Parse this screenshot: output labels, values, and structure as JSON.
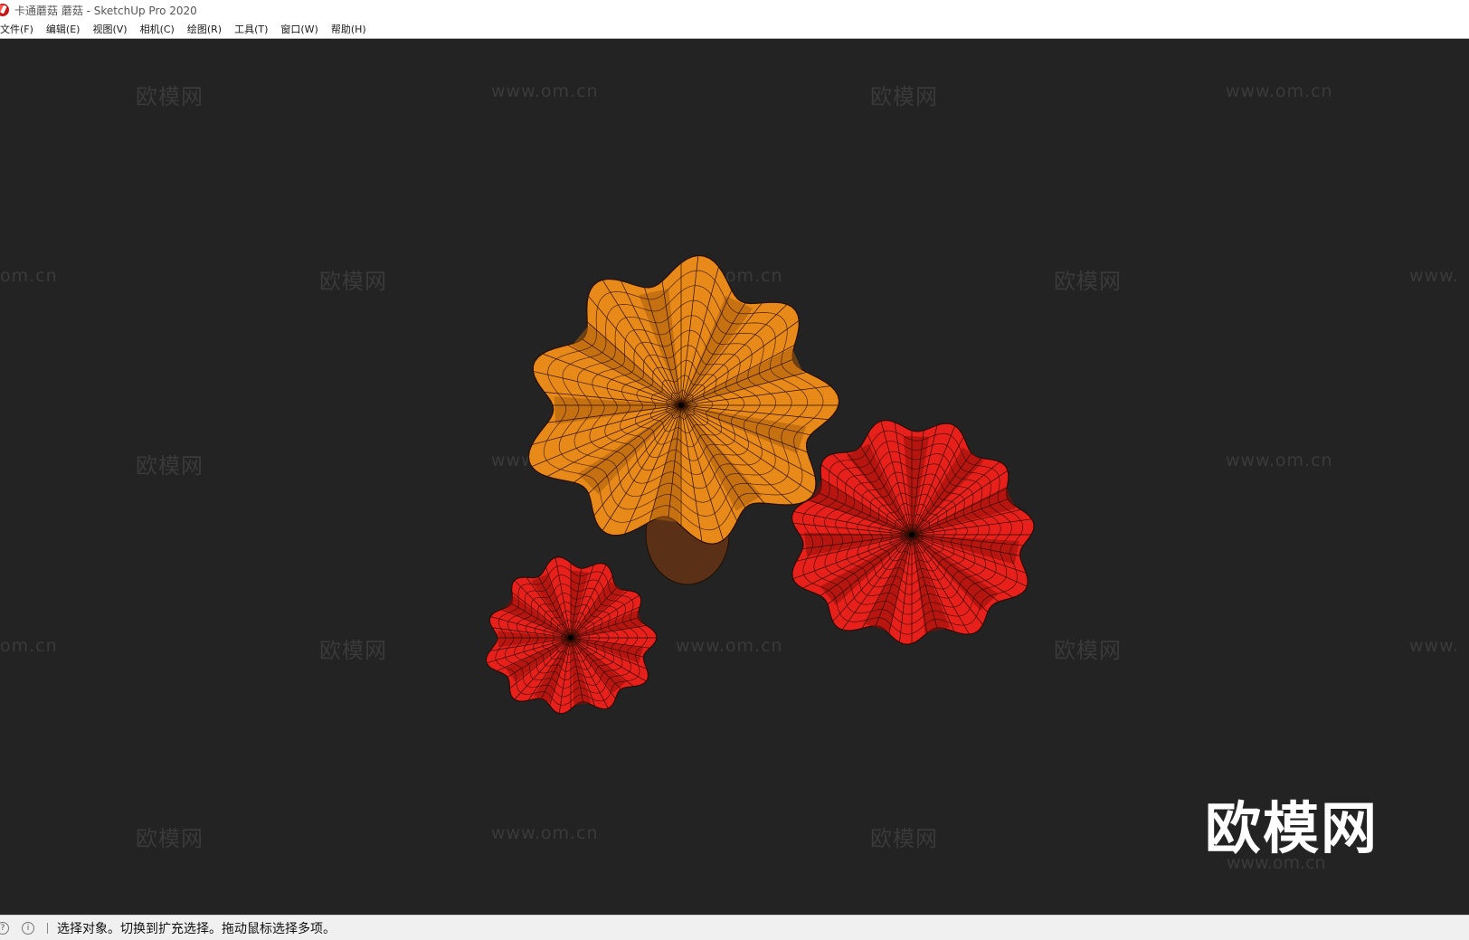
{
  "window": {
    "title": "卡通蘑菇 蘑菇 - SketchUp Pro 2020"
  },
  "menu": [
    {
      "label": "文件(F)"
    },
    {
      "label": "编辑(E)"
    },
    {
      "label": "视图(V)"
    },
    {
      "label": "相机(C)"
    },
    {
      "label": "绘图(R)"
    },
    {
      "label": "工具(T)"
    },
    {
      "label": "窗口(W)"
    },
    {
      "label": "帮助(H)"
    }
  ],
  "watermark": {
    "brand": "欧模网",
    "url": "www.om.cn",
    "url_partial_left": "om.cn",
    "url_partial_right": "www."
  },
  "colors": {
    "viewport_bg": "#232323",
    "orange_cap": "#e88a1a",
    "red_cap": "#e8201c"
  },
  "status": {
    "icons": [
      "help-icon",
      "info-icon"
    ],
    "message": "选择对象。切换到扩充选择。拖动鼠标选择多项。"
  }
}
